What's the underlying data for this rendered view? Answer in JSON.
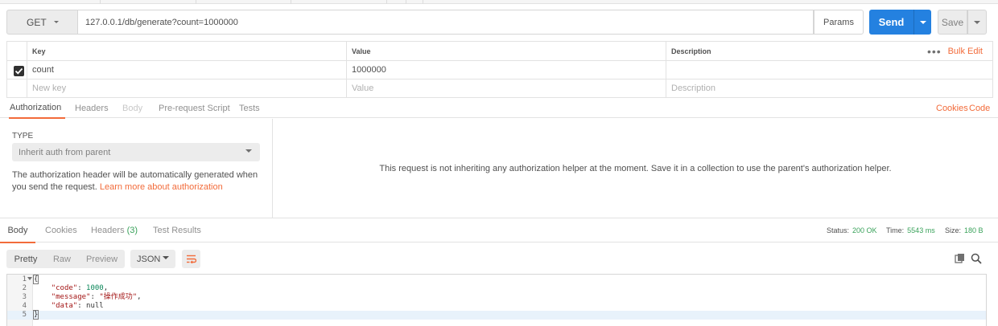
{
  "request": {
    "method": "GET",
    "url": "127.0.0.1/db/generate?count=1000000",
    "params_label": "Params",
    "send_label": "Send",
    "save_label": "Save"
  },
  "params_table": {
    "headers": {
      "key": "Key",
      "value": "Value",
      "description": "Description"
    },
    "bulk_edit": "Bulk Edit",
    "more": "•••",
    "rows": [
      {
        "checked": true,
        "key": "count",
        "value": "1000000",
        "description": ""
      }
    ],
    "new_row": {
      "key_placeholder": "New key",
      "value_placeholder": "Value",
      "description_placeholder": "Description"
    }
  },
  "request_tabs": {
    "items": [
      "Authorization",
      "Headers",
      "Body",
      "Pre-request Script",
      "Tests"
    ],
    "active": "Authorization",
    "cookies_link": "Cookies",
    "code_link": "Code"
  },
  "auth": {
    "type_label": "TYPE",
    "type_value": "Inherit auth from parent",
    "note": "The authorization header will be automatically generated when you send the request.",
    "learn_more": "Learn more about authorization",
    "message": "This request is not inheriting any authorization helper at the moment. Save it in a collection to use the parent's authorization helper."
  },
  "response_tabs": {
    "body": "Body",
    "cookies": "Cookies",
    "headers": "Headers",
    "headers_count": "(3)",
    "test_results": "Test Results"
  },
  "status": {
    "status_label": "Status:",
    "status_value": "200 OK",
    "time_label": "Time:",
    "time_value": "5543 ms",
    "size_label": "Size:",
    "size_value": "180 B"
  },
  "response_toolbar": {
    "pretty": "Pretty",
    "raw": "Raw",
    "preview": "Preview",
    "format": "JSON"
  },
  "response_body": {
    "line_numbers": [
      "1",
      "2",
      "3",
      "4",
      "5"
    ],
    "open_brace": "{",
    "close_brace": "}",
    "code_key": "\"code\"",
    "code_value": "1000",
    "message_key": "\"message\"",
    "message_value": "\"操作成功\"",
    "data_key": "\"data\"",
    "data_value": "null"
  },
  "colors": {
    "accent": "#f26b3a",
    "send": "#2481e0",
    "success": "#3aa25b"
  }
}
